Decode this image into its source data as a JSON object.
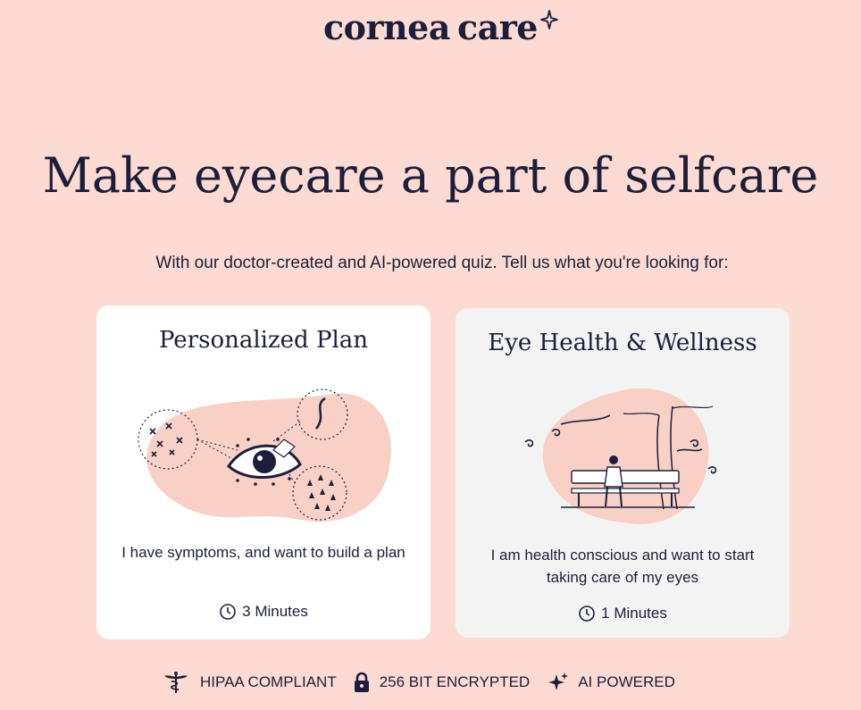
{
  "brand": {
    "name_part1": "cornea",
    "name_part2": "care"
  },
  "hero": {
    "headline": "Make eyecare a part of selfcare",
    "subline": "With our doctor-created and AI-powered quiz. Tell us what you're looking for:"
  },
  "cards": [
    {
      "title": "Personalized Plan",
      "description": "I have symptoms, and want to build a plan",
      "duration": "3 Minutes",
      "illustration": "eye-symptoms-illustration"
    },
    {
      "title": "Eye Health & Wellness",
      "description": "I am health conscious and want to start taking care of my eyes",
      "duration": "1 Minutes",
      "illustration": "person-on-bench-under-tree-illustration"
    }
  ],
  "badges": [
    {
      "icon": "caduceus-icon",
      "label": "HIPAA COMPLIANT"
    },
    {
      "icon": "lock-icon",
      "label": "256 BIT ENCRYPTED"
    },
    {
      "icon": "sparkle-icon",
      "label": "AI POWERED"
    }
  ],
  "colors": {
    "background": "#fddbd2",
    "text": "#1c1f3b",
    "card_primary": "#ffffff",
    "card_secondary": "#f4f3f4",
    "blob": "#f8d0c6"
  }
}
